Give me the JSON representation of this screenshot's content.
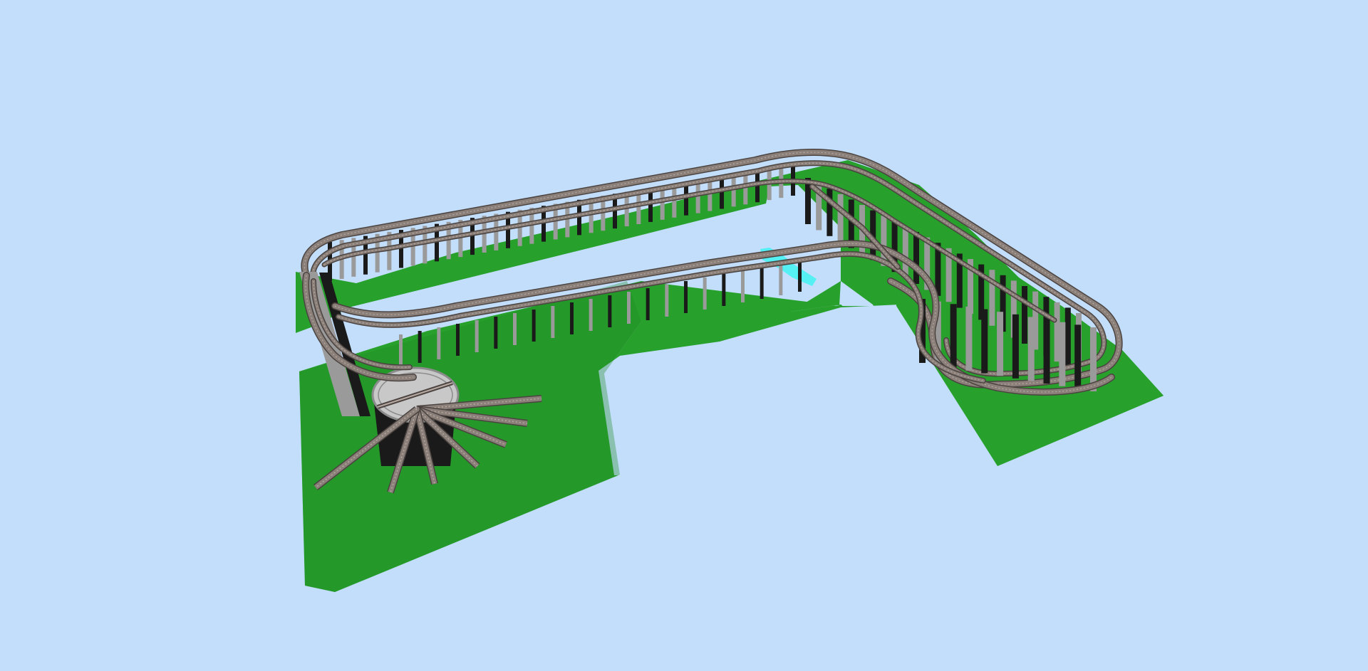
{
  "app": {
    "view": "3d-layout-viewer"
  },
  "colors": {
    "background": "#c2defb",
    "baseboard": "#27a02c",
    "baseboard_shade": "#1f8a25",
    "baseboard_edge": "#16651a",
    "rail": "#8a7f79",
    "rail_light": "#b7a9a2",
    "rail_dark": "#4b4340",
    "pier": "#9a9a9a",
    "pier_dark": "#1a1a1a",
    "turntable": "#c8c8c8",
    "turntable_rim": "#8c8c8c",
    "water": "#54f0f4"
  },
  "scene": {
    "objects": [
      {
        "name": "baseboard",
        "kind": "plane"
      },
      {
        "name": "track-loop",
        "kind": "elevated-track"
      },
      {
        "name": "turntable",
        "kind": "turntable"
      },
      {
        "name": "roundhouse-spurs",
        "kind": "spur-tracks",
        "count": 8
      },
      {
        "name": "water-strip",
        "kind": "water"
      },
      {
        "name": "support-piers",
        "kind": "piers"
      }
    ]
  }
}
